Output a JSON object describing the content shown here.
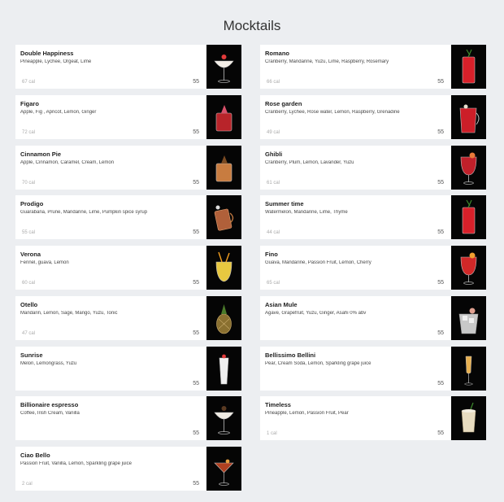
{
  "page": {
    "title": "Mocktails"
  },
  "colors": {
    "background": "#eceef1",
    "card": "#ffffff",
    "photo_bg": "#050505"
  },
  "items": [
    {
      "name": "Double Happiness",
      "ingredients": "Pineapple, Lychee, Orgeat, Lime",
      "calories": "67 cal",
      "price": "55",
      "drink_color": "#f4efe8",
      "garnish": "#e23a3a",
      "icon": "coupe-glass-icon"
    },
    {
      "name": "Romano",
      "ingredients": "Cranberry, Mandarine, Yuzu, Lime, Raspberry, Rosemary",
      "calories": "66 cal",
      "price": "55",
      "drink_color": "#d8202a",
      "garnish": "#3d8a2c",
      "icon": "highball-glass-icon"
    },
    {
      "name": "Figaro",
      "ingredients": "Apple, Fig , Apricot, Lemon, Ginger",
      "calories": "72 cal",
      "price": "55",
      "drink_color": "#b8242a",
      "garnish": "#d8506a",
      "icon": "rocks-glass-icon"
    },
    {
      "name": "Rose garden",
      "ingredients": "Cranberry, Lychee, Rose water, Lemon, Raspberry, Grenadine",
      "calories": "49 cal",
      "price": "55",
      "drink_color": "#cc1e28",
      "garnish": "#e8e0d0",
      "icon": "pitcher-glass-icon"
    },
    {
      "name": "Cinnamon Pie",
      "ingredients": "Apple, Cinnamon, Caramel, Cream, Lemon",
      "calories": "70 cal",
      "price": "55",
      "drink_color": "#c87c40",
      "garnish": "#7a4a22",
      "icon": "rocks-glass-icon"
    },
    {
      "name": "Ghibli",
      "ingredients": "Cranberry, Plum, Lemon, Lavander, Yuzu",
      "calories": "61 cal",
      "price": "55",
      "drink_color": "#c0202a",
      "garnish": "#e87a3a",
      "icon": "goblet-glass-icon"
    },
    {
      "name": "Prodigo",
      "ingredients": "Guarabana, Prune, Mandarine, Lime, Pumpkin spice syrup",
      "calories": "55 cal",
      "price": "55",
      "drink_color": "#b0603a",
      "garnish": "#dddddd",
      "icon": "copper-mug-icon"
    },
    {
      "name": "Summer time",
      "ingredients": "Watermelon, Mandarine, Lime, Thyme",
      "calories": "44 cal",
      "price": "55",
      "drink_color": "#d8202a",
      "garnish": "#3d8a2c",
      "icon": "highball-glass-icon"
    },
    {
      "name": "Verona",
      "ingredients": "Fennel, guava, Lemon",
      "calories": "60 cal",
      "price": "55",
      "drink_color": "#e8c840",
      "garnish": "#f4a020",
      "icon": "tiki-glass-icon"
    },
    {
      "name": "Fino",
      "ingredients": "Guava, Mandarine, Passion Fruit, Lemon, Cherry",
      "calories": "65 cal",
      "price": "55",
      "drink_color": "#d02828",
      "garnish": "#f0a030",
      "icon": "goblet-glass-icon"
    },
    {
      "name": "Otello",
      "ingredients": "Mandarin, Lemon, Sage, Mango, Yuzu, Tonic",
      "calories": "47 cal",
      "price": "55",
      "drink_color": "#8a7030",
      "garnish": "#f0d090",
      "icon": "pineapple-glass-icon"
    },
    {
      "name": "Asian Mule",
      "ingredients": "Agave, Grapefruit, Yuzu, Ginger, Asahi 0% abv",
      "calories": "",
      "price": "55",
      "drink_color": "#c8c8c8",
      "garnish": "#e0a090",
      "icon": "ice-cup-icon"
    },
    {
      "name": "Sunrise",
      "ingredients": "Melon, Lemongrass, Yuzu",
      "calories": "",
      "price": "55",
      "drink_color": "#f0f0f0",
      "garnish": "#e23a3a",
      "icon": "tall-glass-icon"
    },
    {
      "name": "Bellissimo Bellini",
      "ingredients": "Pear, Cream Soda, Lemon, Sparkling grape juice",
      "calories": "",
      "price": "55",
      "drink_color": "#e8b050",
      "garnish": "#e8b050",
      "icon": "flute-glass-icon"
    },
    {
      "name": "Billionaire espresso",
      "ingredients": "Coffee, Irish Cream, Vanilla",
      "calories": "",
      "price": "55",
      "drink_color": "#f0ece4",
      "garnish": "#5a3a22",
      "icon": "coupe-glass-icon"
    },
    {
      "name": "Timeless",
      "ingredients": "Pineapple, Lemon, Passion Fruit, Pear",
      "calories": "1 cal",
      "price": "55",
      "drink_color": "#e8dcc0",
      "garnish": "#3d8a2c",
      "icon": "metal-cup-icon"
    },
    {
      "name": "Ciao Bello",
      "ingredients": "Passion Fruit, Vanilla, Lemon, Sparkling grape juice",
      "calories": "2 cal",
      "price": "55",
      "drink_color": "#b04020",
      "garnish": "#e8a040",
      "icon": "martini-glass-icon"
    }
  ]
}
